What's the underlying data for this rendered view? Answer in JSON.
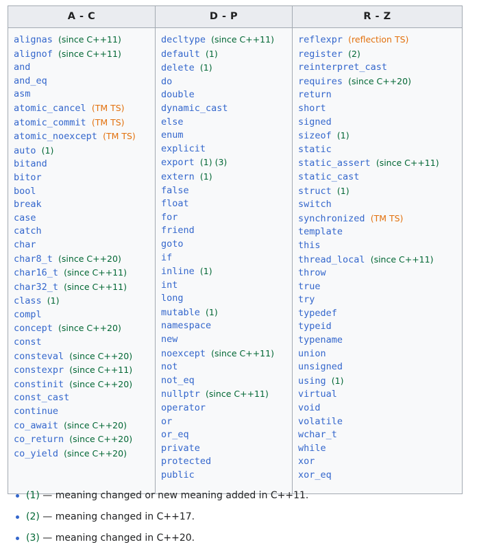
{
  "table": {
    "headers": [
      "A - C",
      "D - P",
      "R - Z"
    ],
    "columns": [
      [
        {
          "kw": "alignas",
          "note": "(since C++11)",
          "note_kind": "ver"
        },
        {
          "kw": "alignof",
          "note": "(since C++11)",
          "note_kind": "ver"
        },
        {
          "kw": "and",
          "note": "",
          "note_kind": ""
        },
        {
          "kw": "and_eq",
          "note": "",
          "note_kind": ""
        },
        {
          "kw": "asm",
          "note": "",
          "note_kind": ""
        },
        {
          "kw": "atomic_cancel",
          "note": "(TM TS)",
          "note_kind": "ts"
        },
        {
          "kw": "atomic_commit",
          "note": "(TM TS)",
          "note_kind": "ts"
        },
        {
          "kw": "atomic_noexcept",
          "note": "(TM TS)",
          "note_kind": "ts"
        },
        {
          "kw": "auto",
          "note": "(1)",
          "note_kind": "ver"
        },
        {
          "kw": "bitand",
          "note": "",
          "note_kind": ""
        },
        {
          "kw": "bitor",
          "note": "",
          "note_kind": ""
        },
        {
          "kw": "bool",
          "note": "",
          "note_kind": ""
        },
        {
          "kw": "break",
          "note": "",
          "note_kind": ""
        },
        {
          "kw": "case",
          "note": "",
          "note_kind": ""
        },
        {
          "kw": "catch",
          "note": "",
          "note_kind": ""
        },
        {
          "kw": "char",
          "note": "",
          "note_kind": ""
        },
        {
          "kw": "char8_t",
          "note": "(since C++20)",
          "note_kind": "ver"
        },
        {
          "kw": "char16_t",
          "note": "(since C++11)",
          "note_kind": "ver"
        },
        {
          "kw": "char32_t",
          "note": "(since C++11)",
          "note_kind": "ver"
        },
        {
          "kw": "class",
          "note": "(1)",
          "note_kind": "ver"
        },
        {
          "kw": "compl",
          "note": "",
          "note_kind": ""
        },
        {
          "kw": "concept",
          "note": "(since C++20)",
          "note_kind": "ver"
        },
        {
          "kw": "const",
          "note": "",
          "note_kind": ""
        },
        {
          "kw": "consteval",
          "note": "(since C++20)",
          "note_kind": "ver"
        },
        {
          "kw": "constexpr",
          "note": "(since C++11)",
          "note_kind": "ver"
        },
        {
          "kw": "constinit",
          "note": "(since C++20)",
          "note_kind": "ver"
        },
        {
          "kw": "const_cast",
          "note": "",
          "note_kind": ""
        },
        {
          "kw": "continue",
          "note": "",
          "note_kind": ""
        },
        {
          "kw": "co_await",
          "note": "(since C++20)",
          "note_kind": "ver"
        },
        {
          "kw": "co_return",
          "note": "(since C++20)",
          "note_kind": "ver"
        },
        {
          "kw": "co_yield",
          "note": "(since C++20)",
          "note_kind": "ver"
        }
      ],
      [
        {
          "kw": "decltype",
          "note": "(since C++11)",
          "note_kind": "ver"
        },
        {
          "kw": "default",
          "note": "(1)",
          "note_kind": "ver"
        },
        {
          "kw": "delete",
          "note": "(1)",
          "note_kind": "ver"
        },
        {
          "kw": "do",
          "note": "",
          "note_kind": ""
        },
        {
          "kw": "double",
          "note": "",
          "note_kind": ""
        },
        {
          "kw": "dynamic_cast",
          "note": "",
          "note_kind": ""
        },
        {
          "kw": "else",
          "note": "",
          "note_kind": ""
        },
        {
          "kw": "enum",
          "note": "",
          "note_kind": ""
        },
        {
          "kw": "explicit",
          "note": "",
          "note_kind": ""
        },
        {
          "kw": "export",
          "note": "(1) (3)",
          "note_kind": "ver"
        },
        {
          "kw": "extern",
          "note": "(1)",
          "note_kind": "ver"
        },
        {
          "kw": "false",
          "note": "",
          "note_kind": ""
        },
        {
          "kw": "float",
          "note": "",
          "note_kind": ""
        },
        {
          "kw": "for",
          "note": "",
          "note_kind": ""
        },
        {
          "kw": "friend",
          "note": "",
          "note_kind": ""
        },
        {
          "kw": "goto",
          "note": "",
          "note_kind": ""
        },
        {
          "kw": "if",
          "note": "",
          "note_kind": ""
        },
        {
          "kw": "inline",
          "note": "(1)",
          "note_kind": "ver"
        },
        {
          "kw": "int",
          "note": "",
          "note_kind": ""
        },
        {
          "kw": "long",
          "note": "",
          "note_kind": ""
        },
        {
          "kw": "mutable",
          "note": "(1)",
          "note_kind": "ver"
        },
        {
          "kw": "namespace",
          "note": "",
          "note_kind": ""
        },
        {
          "kw": "new",
          "note": "",
          "note_kind": ""
        },
        {
          "kw": "noexcept",
          "note": "(since C++11)",
          "note_kind": "ver"
        },
        {
          "kw": "not",
          "note": "",
          "note_kind": ""
        },
        {
          "kw": "not_eq",
          "note": "",
          "note_kind": ""
        },
        {
          "kw": "nullptr",
          "note": "(since C++11)",
          "note_kind": "ver"
        },
        {
          "kw": "operator",
          "note": "",
          "note_kind": ""
        },
        {
          "kw": "or",
          "note": "",
          "note_kind": ""
        },
        {
          "kw": "or_eq",
          "note": "",
          "note_kind": ""
        },
        {
          "kw": "private",
          "note": "",
          "note_kind": ""
        },
        {
          "kw": "protected",
          "note": "",
          "note_kind": ""
        },
        {
          "kw": "public",
          "note": "",
          "note_kind": ""
        }
      ],
      [
        {
          "kw": "reflexpr",
          "note": "(reflection TS)",
          "note_kind": "ts"
        },
        {
          "kw": "register",
          "note": "(2)",
          "note_kind": "ver"
        },
        {
          "kw": "reinterpret_cast",
          "note": "",
          "note_kind": ""
        },
        {
          "kw": "requires",
          "note": "(since C++20)",
          "note_kind": "ver"
        },
        {
          "kw": "return",
          "note": "",
          "note_kind": ""
        },
        {
          "kw": "short",
          "note": "",
          "note_kind": ""
        },
        {
          "kw": "signed",
          "note": "",
          "note_kind": ""
        },
        {
          "kw": "sizeof",
          "note": "(1)",
          "note_kind": "ver"
        },
        {
          "kw": "static",
          "note": "",
          "note_kind": ""
        },
        {
          "kw": "static_assert",
          "note": "(since C++11)",
          "note_kind": "ver"
        },
        {
          "kw": "static_cast",
          "note": "",
          "note_kind": ""
        },
        {
          "kw": "struct",
          "note": "(1)",
          "note_kind": "ver"
        },
        {
          "kw": "switch",
          "note": "",
          "note_kind": ""
        },
        {
          "kw": "synchronized",
          "note": "(TM TS)",
          "note_kind": "ts"
        },
        {
          "kw": "template",
          "note": "",
          "note_kind": ""
        },
        {
          "kw": "this",
          "note": "",
          "note_kind": ""
        },
        {
          "kw": "thread_local",
          "note": "(since C++11)",
          "note_kind": "ver"
        },
        {
          "kw": "throw",
          "note": "",
          "note_kind": ""
        },
        {
          "kw": "true",
          "note": "",
          "note_kind": ""
        },
        {
          "kw": "try",
          "note": "",
          "note_kind": ""
        },
        {
          "kw": "typedef",
          "note": "",
          "note_kind": ""
        },
        {
          "kw": "typeid",
          "note": "",
          "note_kind": ""
        },
        {
          "kw": "typename",
          "note": "",
          "note_kind": ""
        },
        {
          "kw": "union",
          "note": "",
          "note_kind": ""
        },
        {
          "kw": "unsigned",
          "note": "",
          "note_kind": ""
        },
        {
          "kw": "using",
          "note": "(1)",
          "note_kind": "ver"
        },
        {
          "kw": "virtual",
          "note": "",
          "note_kind": ""
        },
        {
          "kw": "void",
          "note": "",
          "note_kind": ""
        },
        {
          "kw": "volatile",
          "note": "",
          "note_kind": ""
        },
        {
          "kw": "wchar_t",
          "note": "",
          "note_kind": ""
        },
        {
          "kw": "while",
          "note": "",
          "note_kind": ""
        },
        {
          "kw": "xor",
          "note": "",
          "note_kind": ""
        },
        {
          "kw": "xor_eq",
          "note": "",
          "note_kind": ""
        }
      ]
    ]
  },
  "footnotes": [
    {
      "ref": "(1)",
      "text": "— meaning changed or new meaning added in C++11."
    },
    {
      "ref": "(2)",
      "text": "— meaning changed in C++17."
    },
    {
      "ref": "(3)",
      "text": "— meaning changed in C++20."
    }
  ],
  "colors": {
    "keyword": "#3366cc",
    "version_note": "#006633",
    "ts_note": "#e2700c",
    "table_border": "#a2a9b1",
    "header_bg": "#eaecf0",
    "cell_bg": "#f8f9fa",
    "text": "#202122"
  }
}
